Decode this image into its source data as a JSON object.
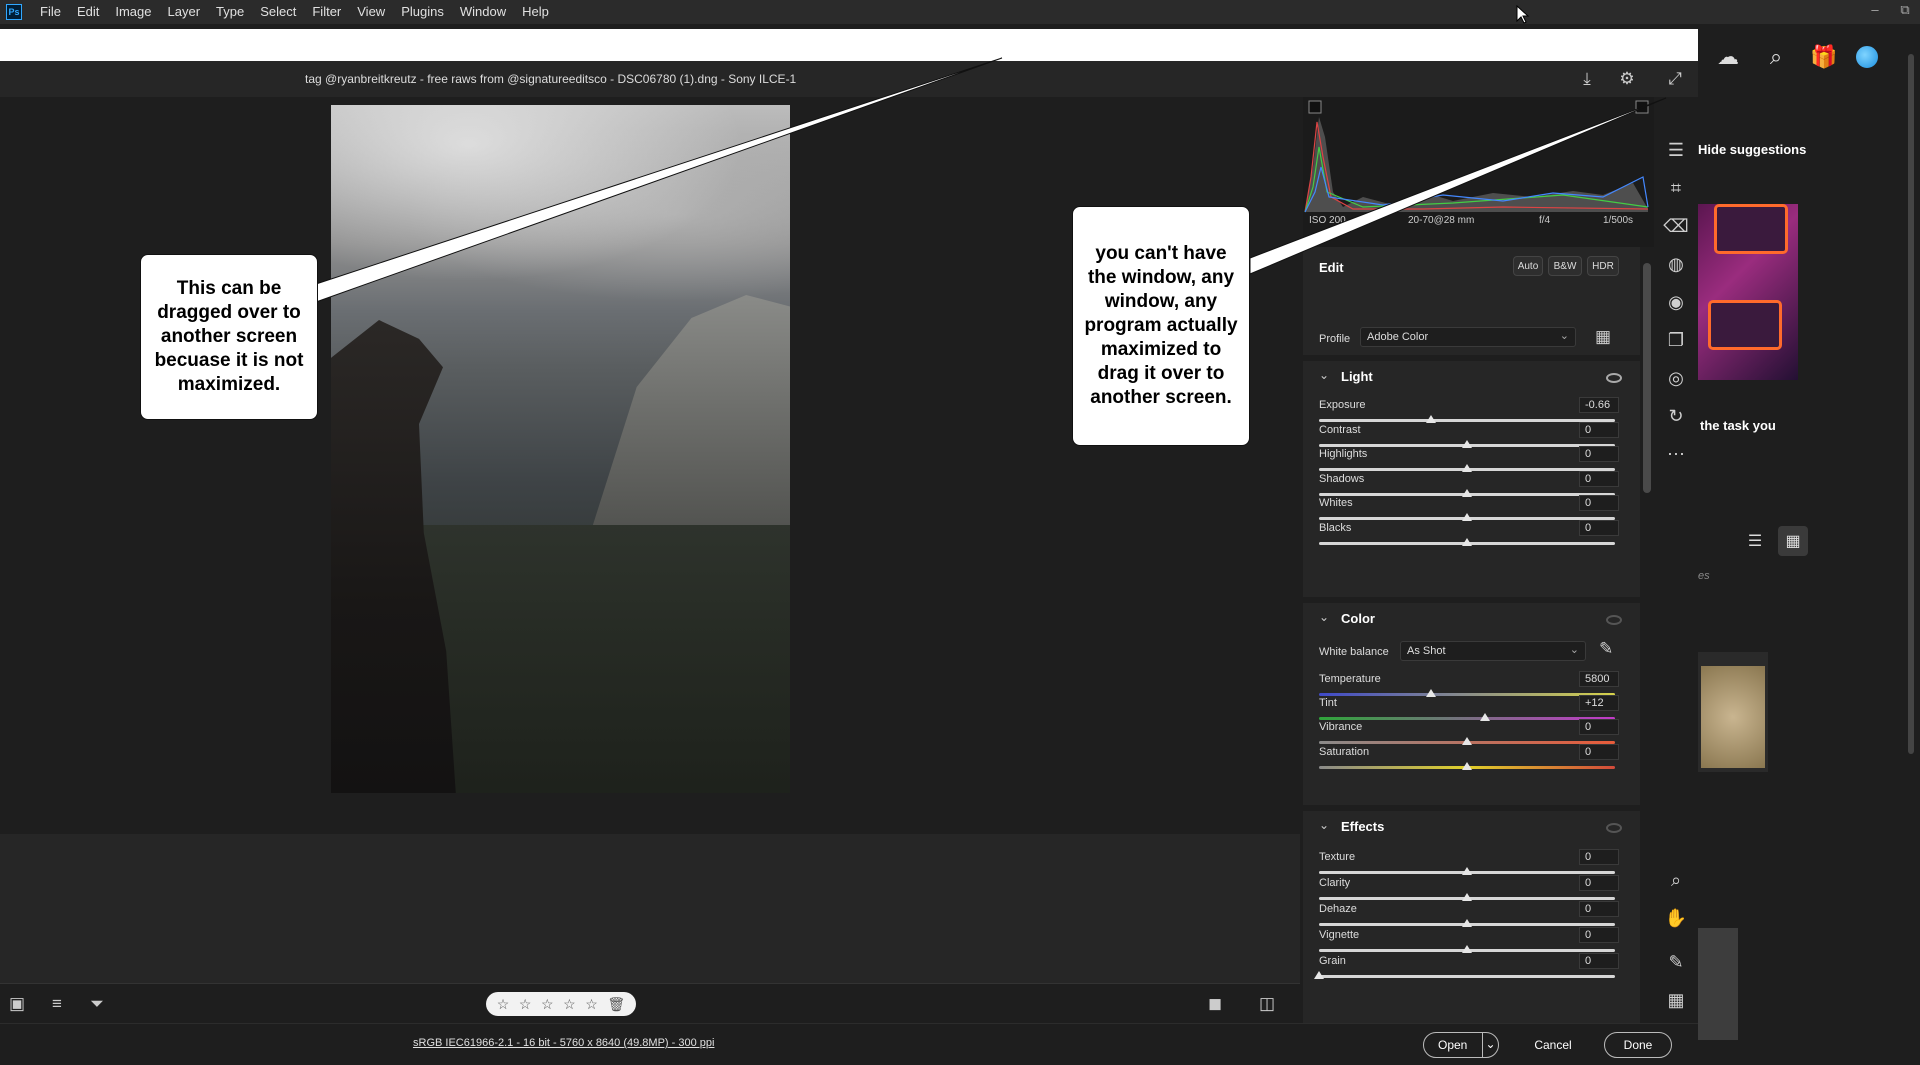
{
  "menubar": {
    "logo": "Ps",
    "items": [
      "File",
      "Edit",
      "Image",
      "Layer",
      "Type",
      "Select",
      "Filter",
      "View",
      "Plugins",
      "Window",
      "Help"
    ]
  },
  "window_controls": {
    "minimize": "–",
    "restore": "⧉"
  },
  "ps_right": {
    "hide_suggestions": "Hide suggestions",
    "task_text": "the task you",
    "side_text": "es"
  },
  "acr": {
    "title": "tag @ryanbreitkreutz - free raws from @signatureeditsco - DSC06780 (1).dng  -  Sony ILCE-1",
    "histogram": {
      "iso": "ISO 200",
      "lens": "20-70@28 mm",
      "aperture": "f/4",
      "shutter": "1/500s"
    },
    "edit": {
      "heading": "Edit",
      "auto": "Auto",
      "bw": "B&W",
      "hdr": "HDR",
      "profile_label": "Profile",
      "profile_value": "Adobe Color"
    },
    "light": {
      "title": "Light",
      "sliders": [
        {
          "label": "Exposure",
          "value": "-0.66",
          "pos": 0.38
        },
        {
          "label": "Contrast",
          "value": "0",
          "pos": 0.5
        },
        {
          "label": "Highlights",
          "value": "0",
          "pos": 0.5
        },
        {
          "label": "Shadows",
          "value": "0",
          "pos": 0.5
        },
        {
          "label": "Whites",
          "value": "0",
          "pos": 0.5
        },
        {
          "label": "Blacks",
          "value": "0",
          "pos": 0.5
        }
      ]
    },
    "color": {
      "title": "Color",
      "wb_label": "White balance",
      "wb_value": "As Shot",
      "sliders": [
        {
          "label": "Temperature",
          "value": "5800",
          "pos": 0.38
        },
        {
          "label": "Tint",
          "value": "+12",
          "pos": 0.56
        },
        {
          "label": "Vibrance",
          "value": "0",
          "pos": 0.5
        },
        {
          "label": "Saturation",
          "value": "0",
          "pos": 0.5
        }
      ]
    },
    "effects": {
      "title": "Effects",
      "sliders": [
        {
          "label": "Texture",
          "value": "0",
          "pos": 0.5
        },
        {
          "label": "Clarity",
          "value": "0",
          "pos": 0.5
        },
        {
          "label": "Dehaze",
          "value": "0",
          "pos": 0.5
        },
        {
          "label": "Vignette",
          "value": "0",
          "pos": 0.5
        },
        {
          "label": "Grain",
          "value": "0",
          "pos": 0.0
        }
      ]
    },
    "footer": {
      "info": "sRGB IEC61966-2.1 - 16 bit - 5760 x 8640 (49.8MP) - 300 ppi",
      "open": "Open",
      "cancel": "Cancel",
      "done": "Done"
    },
    "stars": [
      "☆",
      "☆",
      "☆",
      "☆",
      "☆"
    ]
  },
  "callouts": {
    "left": "This can be dragged over to another screen becuase it is not maximized.",
    "right": "you can't have the window, any window, any program actually maximized to drag it over to another screen."
  },
  "icons": [
    "photoshop-logo",
    "cloud-icon",
    "search-icon",
    "gift-icon",
    "avatar",
    "list-view-icon",
    "grid-view-icon",
    "save-icon",
    "gear-icon",
    "fullscreen-icon",
    "edit-sliders-icon",
    "crop-icon",
    "eraser-icon",
    "mask-icon",
    "red-eye-icon",
    "snapshots-icon",
    "presets-icon",
    "more-icon",
    "zoom-icon",
    "hand-icon",
    "color-sampler-icon",
    "grid-overlay-icon"
  ]
}
